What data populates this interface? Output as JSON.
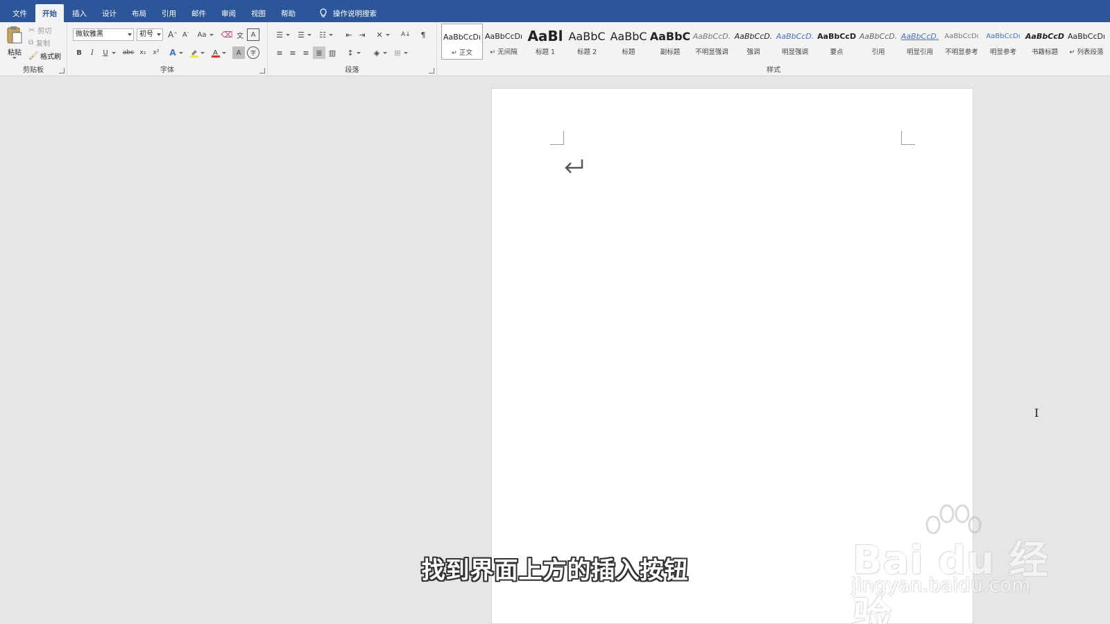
{
  "tabs": [
    "文件",
    "开始",
    "插入",
    "设计",
    "布局",
    "引用",
    "邮件",
    "审阅",
    "视图",
    "帮助"
  ],
  "active_tab": "开始",
  "tell_me": "操作说明搜索",
  "clipboard": {
    "label": "剪贴板",
    "paste": "粘贴",
    "cut": "剪切",
    "copy": "复制",
    "format_painter": "格式刷"
  },
  "font": {
    "label": "字体",
    "family": "微软雅黑",
    "size": "初号",
    "grow": "A",
    "shrink": "A",
    "case": "Aa",
    "bold": "B",
    "italic": "I",
    "underline": "U",
    "strike": "abc",
    "subscript": "x₂",
    "superscript": "x²",
    "phonetic": "文",
    "char_border": "A",
    "char_shading": "A",
    "enclose": "字"
  },
  "paragraph": {
    "label": "段落"
  },
  "styles": {
    "label": "样式",
    "items": [
      {
        "preview": "AaBbCcDı",
        "name": "↵ 正文"
      },
      {
        "preview": "AaBbCcDı",
        "name": "↵ 无间隔"
      },
      {
        "preview": "AaBl",
        "name": "标题 1"
      },
      {
        "preview": "AaBbC",
        "name": "标题 2"
      },
      {
        "preview": "AaBbC",
        "name": "标题"
      },
      {
        "preview": "AaBbC",
        "name": "副标题"
      },
      {
        "preview": "AaBbCcD.",
        "name": "不明显强调"
      },
      {
        "preview": "AaBbCcD.",
        "name": "强调"
      },
      {
        "preview": "AaBbCcD.",
        "name": "明显强调"
      },
      {
        "preview": "AaBbCcD",
        "name": "要点"
      },
      {
        "preview": "AaBbCcD.",
        "name": "引用"
      },
      {
        "preview": "AaBbCcD.",
        "name": "明显引用"
      },
      {
        "preview": "AaBbCcDı",
        "name": "不明显参考"
      },
      {
        "preview": "AaBbCcDı",
        "name": "明显参考"
      },
      {
        "preview": "AaBbCcD",
        "name": "书籍标题"
      },
      {
        "preview": "AaBbCcDı",
        "name": "↵ 列表段落"
      }
    ]
  },
  "document": {
    "paragraph_mark": "↵"
  },
  "subtitle": "找到界面上方的插入按钮",
  "watermark": {
    "brand": "Bai du 经验",
    "url": "jingyan.baidu.com"
  },
  "colors": {
    "accent": "#2b579a",
    "font_color": "#e0321e",
    "highlight": "#f5e642"
  }
}
